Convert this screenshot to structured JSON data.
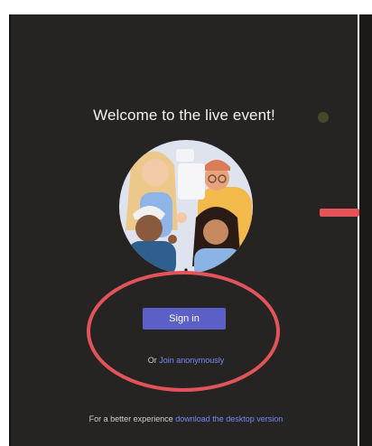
{
  "welcome": {
    "title": "Welcome to the live event!"
  },
  "actions": {
    "sign_in_label": "Sign in",
    "anon_prefix": "Or",
    "anon_link": "Join anonymously"
  },
  "footer": {
    "prefix": "For a better experience",
    "link": "download the desktop version"
  },
  "colors": {
    "background": "#252423",
    "primary_button": "#5b5fc7",
    "link": "#7f85f5",
    "annotation": "#e3545a"
  },
  "icons": {
    "illustration": "people-group-illustration",
    "annotation_circle": "red-highlight-circle",
    "annotation_arrow": "red-arrow"
  }
}
